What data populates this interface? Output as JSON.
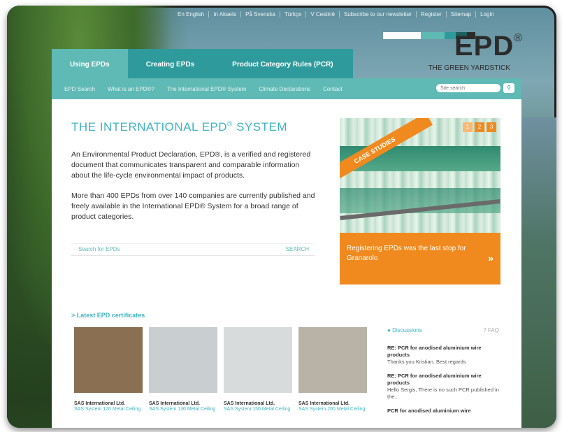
{
  "top_nav": [
    "En English",
    "In Akaets",
    "På Svenska",
    "Türkçe",
    "V Cestině",
    "Subscribe to our newsletter",
    "Register",
    "Sitemap",
    "Login"
  ],
  "logo": {
    "word": "EPD",
    "reg": "®",
    "tagline": "THE GREEN YARDSTICK",
    "bar_colors": [
      "#ffffff",
      "#5fb9b5",
      "#2f9a9b",
      "#1b5f5f",
      "#2b2b2b"
    ]
  },
  "tabs": [
    "Using EPDs",
    "Creating EPDs",
    "Product Category Rules (PCR)"
  ],
  "subnav": [
    "EPD Search",
    "What is an EPD®?",
    "The International EPD® System",
    "Climate Declarations",
    "Contact"
  ],
  "site_search": {
    "placeholder": "Site search"
  },
  "hero": {
    "title": "THE INTERNATIONAL EPD",
    "title_sup": "®",
    "title_end": " SYSTEM",
    "para1": "An Environmental Product Declaration, EPD®, is a verified and registered document that communicates transparent and comparable information about the life-cycle environmental impact of products.",
    "para2": "More than 400 EPDs from over 140 companies are currently published and freely available in the International EPD® System for a broad range of product categories."
  },
  "epd_search": {
    "placeholder": "Search for EPDs",
    "button": "SEARCH"
  },
  "case_study": {
    "ribbon": "CASE STUDIES",
    "pages": [
      "1",
      "2",
      "3"
    ],
    "caption": "Registering EPDs was the last stop for Granarolo",
    "more": "»"
  },
  "latest": {
    "heading": "> Latest EPD certificates"
  },
  "certificates": [
    {
      "company": "SAS International Ltd.",
      "product": "SAS System 120 Metal Ceiling",
      "tone": "#8a6f52"
    },
    {
      "company": "SAS International Ltd.",
      "product": "SAS System 130 Metal Ceiling",
      "tone": "#c9ced1"
    },
    {
      "company": "SAS International Ltd.",
      "product": "SAS System 150 Metal Ceiling",
      "tone": "#d7dbdc"
    },
    {
      "company": "SAS International Ltd.",
      "product": "SAS System 200 Metal Ceiling",
      "tone": "#b9b2a6"
    }
  ],
  "discussions": {
    "tab": "Discussions",
    "faq": "? FAQ",
    "items": [
      {
        "title": "RE: PCR for anodised aluminium wire products",
        "snippet": "Thanks you Kristian. Best regards"
      },
      {
        "title": "RE: PCR for anodised aluminium wire products",
        "snippet": "Hello Sergis, There is no such PCR published in the..."
      },
      {
        "title": "PCR for anodised aluminium wire",
        "snippet": ""
      }
    ]
  }
}
